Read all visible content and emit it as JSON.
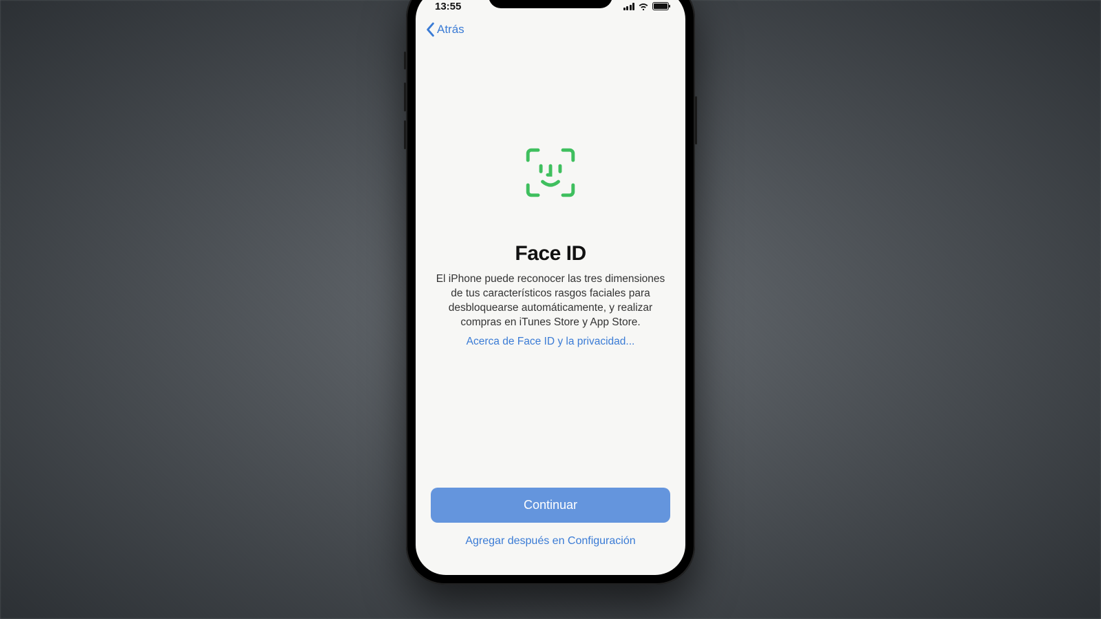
{
  "status": {
    "time": "13:55"
  },
  "nav": {
    "back_label": "Atrás"
  },
  "main": {
    "title": "Face ID",
    "description": "El iPhone puede reconocer las tres dimensiones de tus característicos rasgos faciales para desbloquearse automáticamente, y realizar compras en iTunes Store y App Store.",
    "privacy_link": "Acerca de Face ID y la privacidad..."
  },
  "actions": {
    "continue_label": "Continuar",
    "later_label": "Agregar después en Configuración"
  },
  "colors": {
    "accent": "#3a7bd5",
    "primary_button": "#6495dd",
    "faceid_green": "#3fbf5e"
  }
}
